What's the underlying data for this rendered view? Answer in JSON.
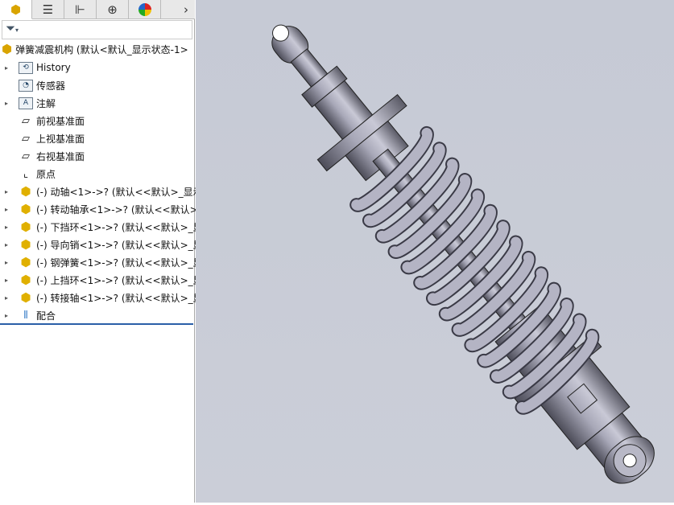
{
  "tabs": [
    {
      "icon": "feature-manager-icon"
    },
    {
      "icon": "property-manager-icon"
    },
    {
      "icon": "configuration-manager-icon"
    },
    {
      "icon": "dimxpert-icon"
    },
    {
      "icon": "display-manager-icon"
    },
    {
      "icon": "chevron-right-icon"
    }
  ],
  "filter": {
    "icon": "filter-icon"
  },
  "root": {
    "label": "弹簧减震机构  (默认<默认_显示状态-1>"
  },
  "tree": [
    {
      "label": "History",
      "icon": "history-folder-icon",
      "expand": true
    },
    {
      "label": "传感器",
      "icon": "sensors-folder-icon",
      "expand": false
    },
    {
      "label": "注解",
      "icon": "annotations-folder-icon",
      "expand": true
    },
    {
      "label": "前视基准面",
      "icon": "plane-icon",
      "expand": false
    },
    {
      "label": "上视基准面",
      "icon": "plane-icon",
      "expand": false
    },
    {
      "label": "右视基准面",
      "icon": "plane-icon",
      "expand": false
    },
    {
      "label": "原点",
      "icon": "origin-icon",
      "expand": false
    },
    {
      "label": "(-) 动轴<1>->? (默认<<默认>_显示",
      "icon": "part-icon",
      "expand": true
    },
    {
      "label": "(-) 转动轴承<1>->? (默认<<默认>",
      "icon": "part-icon",
      "expand": true
    },
    {
      "label": "(-) 下挡环<1>->? (默认<<默认>_显",
      "icon": "part-icon",
      "expand": true
    },
    {
      "label": "(-) 导向销<1>->? (默认<<默认>_显",
      "icon": "part-icon",
      "expand": true
    },
    {
      "label": "(-) 钢弹簧<1>->? (默认<<默认>_显",
      "icon": "part-icon",
      "expand": true
    },
    {
      "label": "(-) 上挡环<1>->? (默认<<默认>_显",
      "icon": "part-icon",
      "expand": true
    },
    {
      "label": "(-) 转接轴<1>->? (默认<<默认>_显",
      "icon": "part-icon",
      "expand": true
    },
    {
      "label": "配合",
      "icon": "mates-icon",
      "expand": true
    }
  ]
}
